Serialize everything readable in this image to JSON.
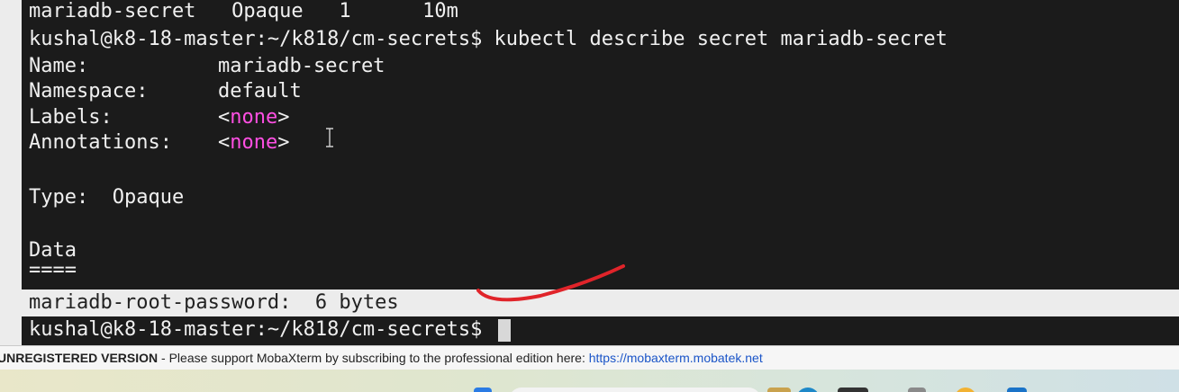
{
  "terminal": {
    "line_prev": "mariadb-secret   Opaque   1      10m",
    "command_line": "kushal@k8-18-master:~/k818/cm-secrets$ kubectl describe secret mariadb-secret",
    "name": {
      "key": "Name:",
      "value": "mariadb-secret"
    },
    "namespace": {
      "key": "Namespace:",
      "value": "default"
    },
    "labels": {
      "key": "Labels:",
      "open": "<",
      "value": "none",
      "close": ">"
    },
    "annotations": {
      "key": "Annotations:",
      "open": "<",
      "value": "none",
      "close": ">"
    },
    "type_line": "Type:  Opaque",
    "data_header": "Data",
    "separator": "====",
    "data_entry": "mariadb-root-password:  6 bytes",
    "prompt": "kushal@k8-18-master:~/k818/cm-secrets$ "
  },
  "status_bar": {
    "unregistered": "UNREGISTERED VERSION",
    "message": "  -  Please support MobaXterm by subscribing to the professional edition here:  ",
    "link": "https://mobaxterm.mobatek.net"
  },
  "colors": {
    "terminal_bg": "#1b1b1b",
    "terminal_fg": "#f0f0f0",
    "highlight": "#ff4fe3",
    "annotation_stroke": "#e0242a",
    "link": "#1b55c8"
  }
}
